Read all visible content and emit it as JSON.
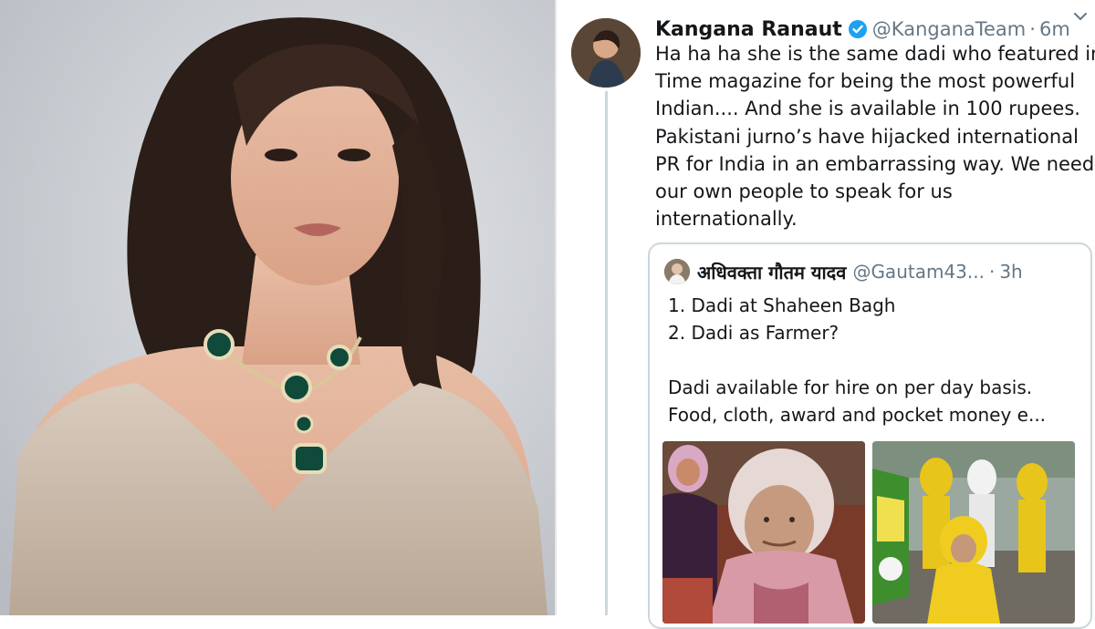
{
  "tweet": {
    "author_name": "Kangana Ranaut",
    "handle": "@KanganaTeam",
    "separator": "·",
    "time": "6m",
    "lines": [
      "Ha ha ha she is the same dadi who featured in",
      "Time magazine for being the most powerful",
      "Indian.... And she is available in 100 rupees.",
      "Pakistani jurno’s have hijacked international",
      "PR for India in an embarrassing way. We need",
      "our own people to speak for us",
      "internationally."
    ],
    "icons": {
      "verified": "verified-badge-icon",
      "menu": "chevron-down-icon"
    },
    "colors": {
      "verified_blue": "#1da1f2",
      "muted": "#657786",
      "border": "#ccd6dd"
    }
  },
  "quoted_tweet": {
    "author_name": "अधिवक्ता गौतम यादव",
    "handle": "@Gautam43...",
    "separator": "·",
    "time": "3h",
    "lines": [
      "1. Dadi at Shaheen Bagh",
      "2. Dadi as Farmer?",
      "",
      "Dadi available for hire on per day basis.",
      "Food, cloth, award and pocket money e..."
    ],
    "media": [
      "elderly-woman-photo",
      "farmers-protest-photo"
    ]
  }
}
